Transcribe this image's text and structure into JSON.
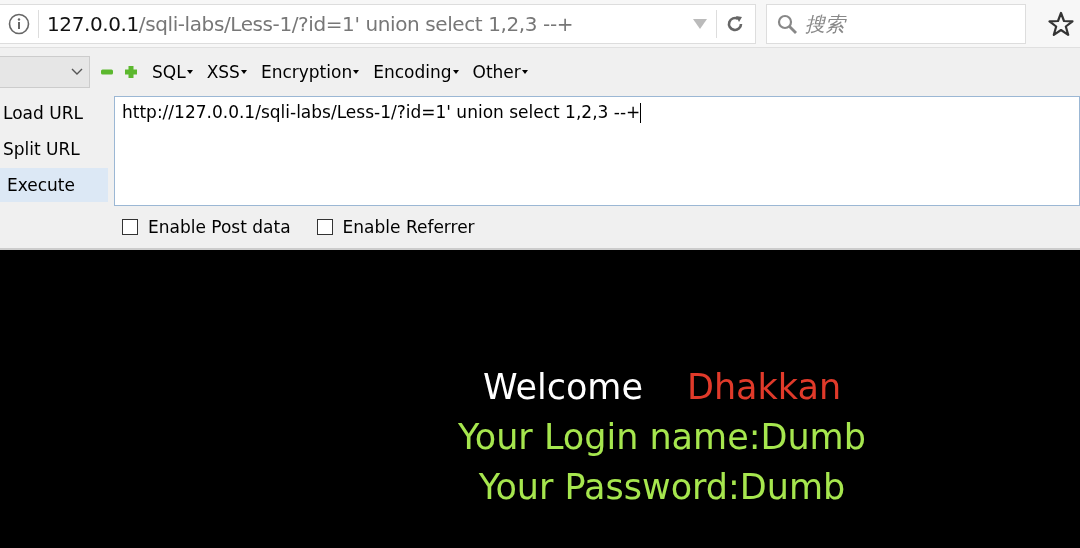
{
  "address_bar": {
    "host": "127.0.0.1",
    "path": "/sqli-labs/Less-1/?id=1' union select 1,2,3 --+"
  },
  "search": {
    "placeholder": "搜索"
  },
  "toolbar": {
    "menus": [
      "SQL",
      "XSS",
      "Encryption",
      "Encoding",
      "Other"
    ]
  },
  "side_buttons": [
    {
      "label": "Load URL",
      "selected": false
    },
    {
      "label": "Split URL",
      "selected": false
    },
    {
      "label": "Execute",
      "selected": true
    }
  ],
  "url_field": {
    "value": "http://127.0.0.1/sqli-labs/Less-1/?id=1' union select 1,2,3 --+"
  },
  "options": [
    {
      "label": "Enable Post data",
      "checked": false
    },
    {
      "label": "Enable Referrer",
      "checked": false
    }
  ],
  "page": {
    "welcome": "Welcome",
    "name": "Dhakkan",
    "login": "Your Login name:Dumb",
    "password": "Your Password:Dumb"
  }
}
